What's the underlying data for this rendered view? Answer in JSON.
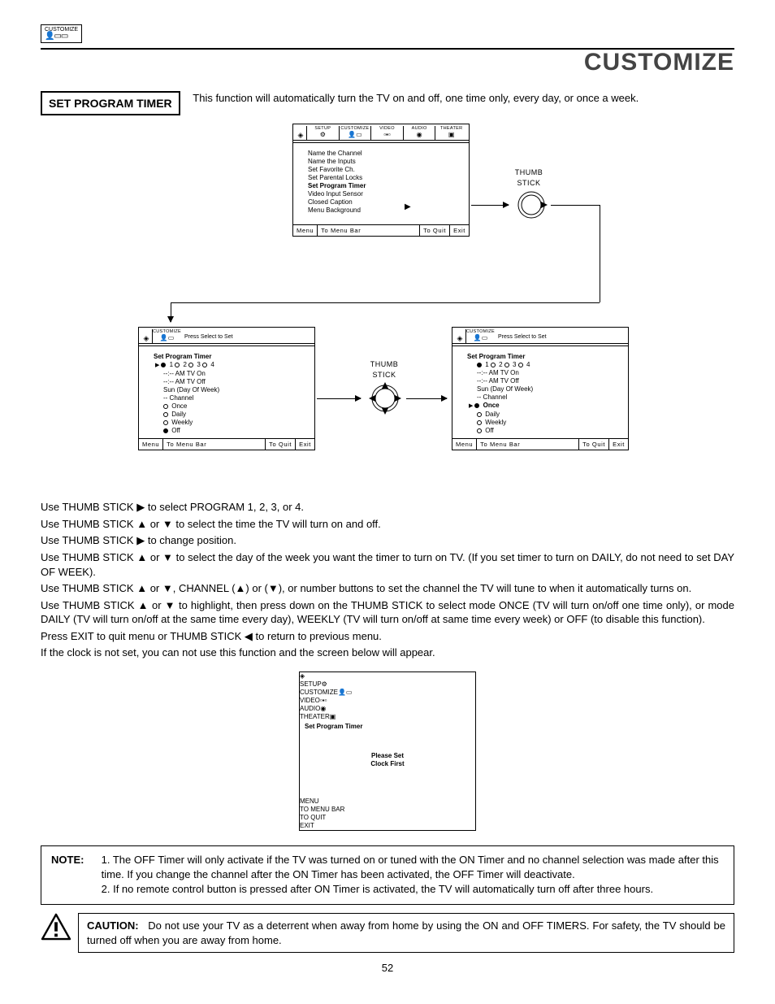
{
  "header": {
    "icon_label": "CUSTOMIZE",
    "page_title": "CUSTOMIZE"
  },
  "section": {
    "title": "SET PROGRAM TIMER",
    "desc": "This function will automatically turn the TV on and off, one time only, every day, or once a week."
  },
  "tabs": {
    "setup": "SETUP",
    "customize": "CUSTOMIZE",
    "video": "VIDEO",
    "audio": "AUDIO",
    "theater": "THEATER"
  },
  "menu1": {
    "items": [
      "Name the Channel",
      "Name the Inputs",
      "Set Favorite Ch.",
      "Set Parental Locks",
      "Set Program Timer",
      "Video Input Sensor",
      "Closed Caption",
      "Menu Background"
    ],
    "selected_index": 4
  },
  "footer": {
    "menu": "Menu",
    "bar": "To Menu Bar",
    "quit": "To Quit",
    "exit": "Exit"
  },
  "footer_caps": {
    "menu": "MENU",
    "bar": "TO MENU BAR",
    "quit": "TO QUIT",
    "exit": "EXIT"
  },
  "thumb_label": "THUMB STICK",
  "submenu_hdr": "Press Select to Set",
  "timer_menu": {
    "title": "Set Program Timer",
    "slots": [
      "1",
      "2",
      "3",
      "4"
    ],
    "lines": [
      "--:-- AM TV On",
      "--:-- AM TV Off",
      "Sun (Day Of Week)",
      "-- Channel"
    ],
    "modes": [
      "Once",
      "Daily",
      "Weekly",
      "Off"
    ]
  },
  "menu2_selected_slot": 0,
  "menu2_selected_mode": 3,
  "menu3_selected_mode": 0,
  "clock_menu": {
    "title": "Set Program Timer",
    "msg1": "Please Set",
    "msg2": "Clock First"
  },
  "instructions": [
    "Use THUMB STICK ▶ to select PROGRAM 1, 2, 3, or 4.",
    "Use THUMB STICK ▲ or ▼ to select the time the TV will turn on and off.",
    "Use THUMB STICK ▶ to change position.",
    "Use THUMB STICK ▲ or ▼ to select the day of the week you want the timer to turn on TV. (If you set timer to turn on DAILY, do not need to set DAY OF WEEK).",
    "Use THUMB STICK ▲ or ▼, CHANNEL (▲) or (▼), or number buttons to set the channel the TV will tune to when it automatically turns on.",
    "Use THUMB STICK ▲ or ▼ to highlight, then press down on the THUMB STICK to select mode ONCE (TV will turn on/off one time only), or mode DAILY (TV will turn on/off at the same time every day), WEEKLY (TV will turn on/off at same time every week) or OFF (to disable this function).",
    "Press EXIT to quit menu or THUMB STICK ◀ to return to previous menu.",
    "If the clock is not set, you can not use this function and the screen below will appear."
  ],
  "note": {
    "label": "NOTE:",
    "item1": "1. The OFF Timer will only activate if the TV was turned on or tuned with the ON Timer and no channel selection was made after this time.  If you change the channel after the ON Timer has been activated, the OFF Timer will deactivate.",
    "item2": "2. If no remote control button is pressed after ON Timer is activated, the TV will automatically turn off after three hours."
  },
  "caution": {
    "label": "CAUTION:",
    "text": "Do not use your TV as a deterrent when away from home by using the ON and OFF TIMERS.  For safety, the TV should be turned off when you are away from home."
  },
  "page_number": "52"
}
